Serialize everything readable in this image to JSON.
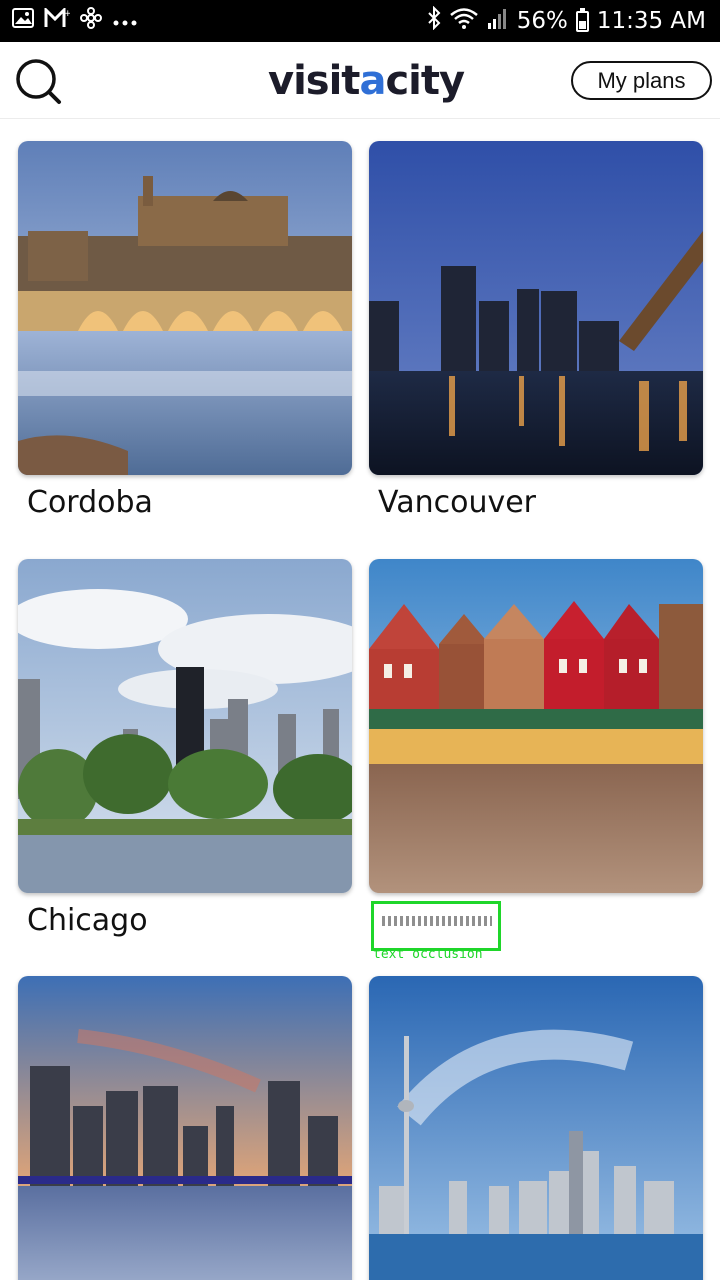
{
  "status_bar": {
    "left_icons": [
      "image-icon",
      "gmail-icon",
      "pinwheel-icon",
      "more-dots-icon"
    ],
    "battery_percent": "56%",
    "battery_level": 0.56,
    "time": "11:35 AM"
  },
  "header": {
    "logo_main": "visit",
    "logo_accent": "a",
    "logo_tail": "city",
    "my_plans_label": "My plans",
    "accent_color": "#2f6fd6"
  },
  "cities": [
    {
      "name": "Cordoba"
    },
    {
      "name": "Vancouver"
    },
    {
      "name": "Chicago"
    },
    {
      "name": ""
    },
    {
      "name": ""
    },
    {
      "name": ""
    }
  ],
  "occlusion": {
    "label": "text occlusion"
  }
}
